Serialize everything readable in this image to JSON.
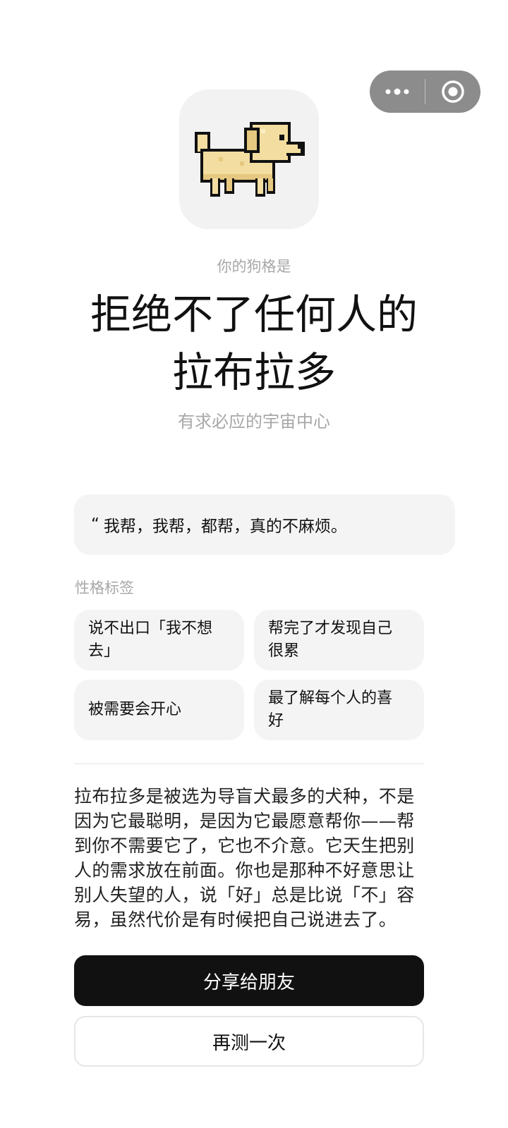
{
  "capsule": {
    "more_icon": "more-dots-icon",
    "close_icon": "target-circle-icon"
  },
  "result": {
    "avatar_icon": "pixel-labrador-dog-icon",
    "intro": "你的狗格是",
    "title_line1": "拒绝不了任何人的",
    "title_line2": "拉布拉多",
    "tagline": "有求必应的宇宙中心"
  },
  "quote": {
    "mark": "“",
    "text": "我帮，我帮，都帮，真的不麻烦。"
  },
  "traits": {
    "label": "性格标签",
    "items": [
      {
        "line1": "说不出口「我不想",
        "line2": "去」"
      },
      {
        "line1": "帮完了才发现自己",
        "line2": "很累"
      },
      {
        "line1": "被需要会开心",
        "line2": ""
      },
      {
        "line1": "最了解每个人的喜",
        "line2": "好"
      }
    ]
  },
  "description": [
    "拉布拉多是被选为导盲犬最多的犬种，不是",
    "因为它最聪明，是因为它最愿意帮你——帮",
    "到你不需要它了，它也不介意。它天生把别",
    "人的需求放在前面。你也是那种不好意思让",
    "别人失望的人，说「好」总是比说「不」容",
    "易，虽然代价是有时候把自己说进去了。"
  ],
  "buttons": {
    "share": "分享给朋友",
    "retry": "再测一次"
  },
  "colors": {
    "primary_button": "#111111",
    "secondary_text": "#a8a8a8",
    "card_bg": "#f4f4f4",
    "dog_body": "#f3dda0"
  }
}
